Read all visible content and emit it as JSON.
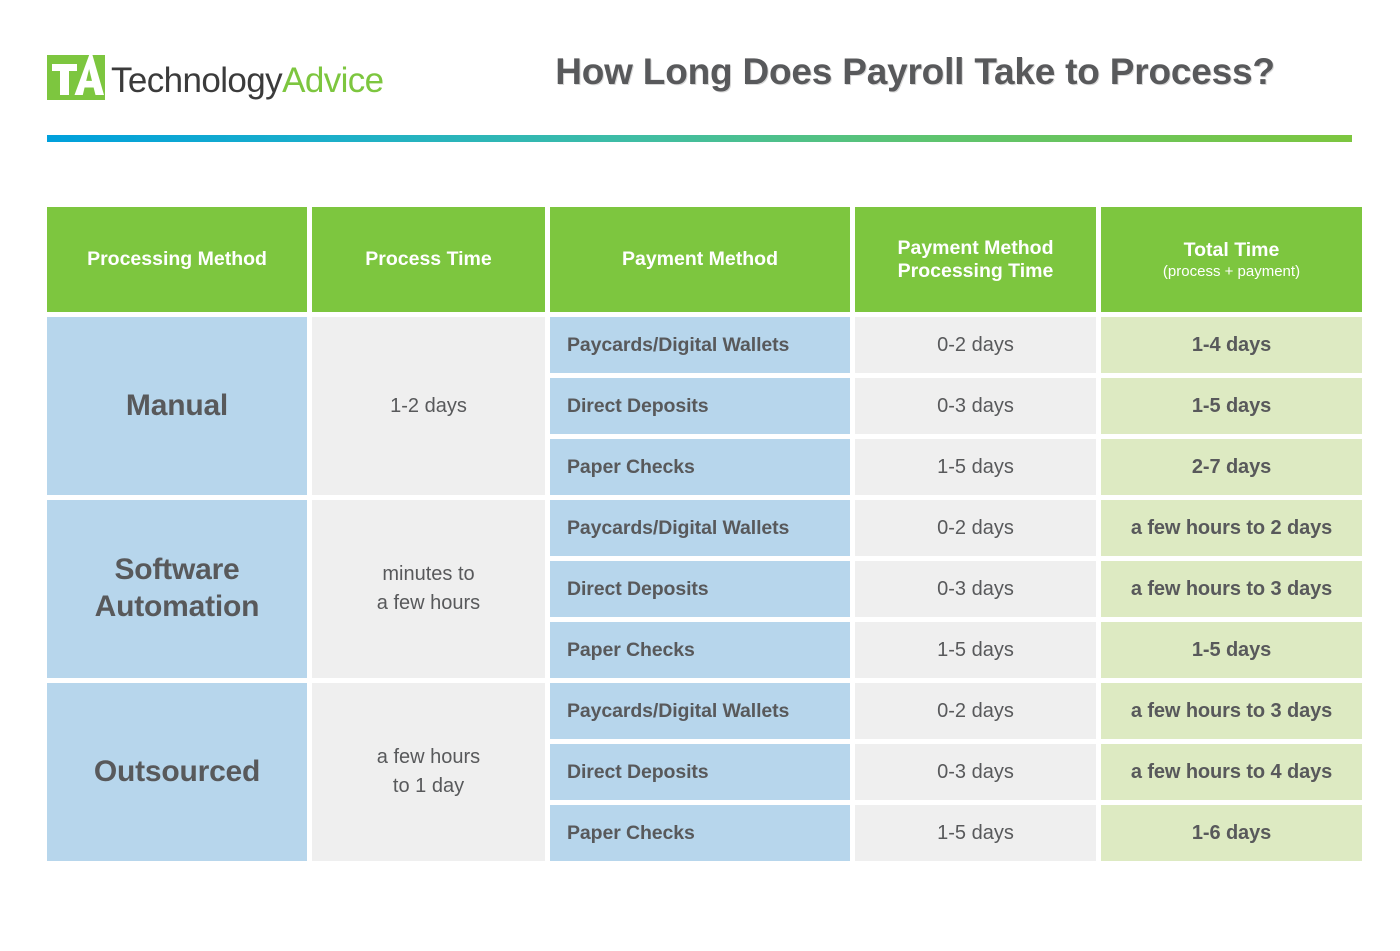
{
  "brand": {
    "logo_mark_text": "TA",
    "logo_word_primary": "Technology",
    "logo_word_accent": "Advice",
    "logo_mark_color": "#7DC63F",
    "word_primary_color": "#3b3b3b",
    "word_accent_color": "#7DC63F"
  },
  "header": {
    "title": "How Long Does Payroll Take to Process?",
    "title_color": "#58595b",
    "divider_gradient_from": "#00A0DC",
    "divider_gradient_to": "#7DC63F"
  },
  "colors": {
    "header_green": "#7DC63F",
    "cell_blue": "#B7D6EC",
    "cell_gray": "#EFEFEF",
    "cell_light_green": "#DDEAC2",
    "text_dark": "#58595b"
  },
  "table": {
    "columns": [
      {
        "label": "Processing Method",
        "sub": ""
      },
      {
        "label": "Process Time",
        "sub": ""
      },
      {
        "label": "Payment Method",
        "sub": ""
      },
      {
        "label": "Payment Method\nProcessing Time",
        "line1": "Payment Method",
        "line2": "Processing Time",
        "sub": ""
      },
      {
        "label": "Total Time",
        "sub": "(process + payment)"
      }
    ],
    "groups": [
      {
        "method_line1": "Manual",
        "method_line2": "",
        "process_time_line1": "1-2 days",
        "process_time_line2": "",
        "rows": [
          {
            "payment_method": "Paycards/Digital Wallets",
            "payment_processing_time": "0-2 days",
            "total_time": "1-4 days"
          },
          {
            "payment_method": "Direct Deposits",
            "payment_processing_time": "0-3 days",
            "total_time": "1-5 days"
          },
          {
            "payment_method": "Paper Checks",
            "payment_processing_time": "1-5 days",
            "total_time": "2-7 days"
          }
        ]
      },
      {
        "method_line1": "Software",
        "method_line2": "Automation",
        "process_time_line1": "minutes to",
        "process_time_line2": "a few hours",
        "rows": [
          {
            "payment_method": "Paycards/Digital Wallets",
            "payment_processing_time": "0-2 days",
            "total_time": "a few hours to 2 days"
          },
          {
            "payment_method": "Direct Deposits",
            "payment_processing_time": "0-3 days",
            "total_time": "a few hours to 3 days"
          },
          {
            "payment_method": "Paper Checks",
            "payment_processing_time": "1-5 days",
            "total_time": "1-5 days"
          }
        ]
      },
      {
        "method_line1": "Outsourced",
        "method_line2": "",
        "process_time_line1": "a few hours",
        "process_time_line2": "to 1 day",
        "rows": [
          {
            "payment_method": "Paycards/Digital Wallets",
            "payment_processing_time": "0-2 days",
            "total_time": "a few hours to 3 days"
          },
          {
            "payment_method": "Direct Deposits",
            "payment_processing_time": "0-3 days",
            "total_time": "a few hours to 4 days"
          },
          {
            "payment_method": "Paper Checks",
            "payment_processing_time": "1-5 days",
            "total_time": "1-6 days"
          }
        ]
      }
    ]
  }
}
